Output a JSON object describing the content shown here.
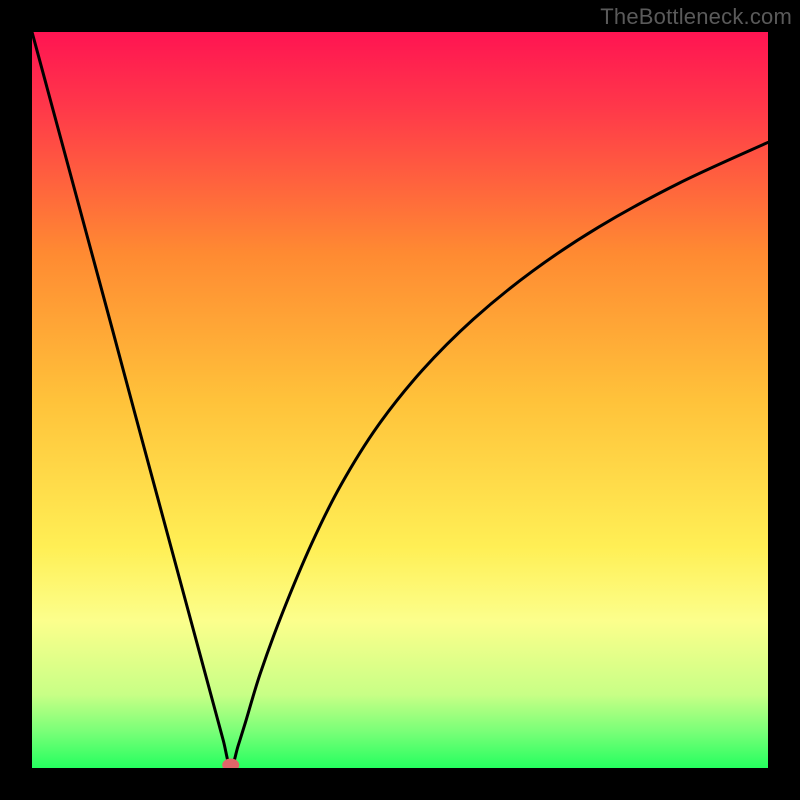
{
  "watermark": "TheBottleneck.com",
  "colors": {
    "frame": "#000000",
    "gradient_top": "#ff1452",
    "gradient_mid_upper": "#ff7a2e",
    "gradient_mid": "#ffb436",
    "gradient_mid_lower": "#ffe74a",
    "gradient_light": "#fbff8a",
    "gradient_green_light": "#b0ff7a",
    "gradient_green": "#2aff67",
    "curve": "#000000",
    "marker": "#e0666a"
  },
  "chart_data": {
    "type": "line",
    "title": "",
    "xlabel": "",
    "ylabel": "",
    "xlim": [
      0,
      100
    ],
    "ylim": [
      0,
      100
    ],
    "curve_notes": "V-shaped bottleneck curve: starts at (0,100), descends steeply and nearly linearly to a minimum near x≈27 where y≈0, then rises with decreasing slope approaching ~85 at x=100.",
    "series": [
      {
        "name": "curve",
        "x": [
          0,
          2,
          5,
          8,
          11,
          14,
          17,
          20,
          23,
          25,
          26,
          27,
          28,
          29,
          31,
          34,
          38,
          42,
          47,
          53,
          60,
          68,
          77,
          88,
          100
        ],
        "y": [
          100,
          92.6,
          81.5,
          70.4,
          59.3,
          48.1,
          37.0,
          25.9,
          14.8,
          7.4,
          3.7,
          0.0,
          3.0,
          6.2,
          12.8,
          21.0,
          30.5,
          38.5,
          46.5,
          54.0,
          61.0,
          67.5,
          73.5,
          79.5,
          85.0
        ]
      }
    ],
    "marker": {
      "x": 27,
      "y": 0
    },
    "gradient_stops": [
      {
        "offset": 0.0,
        "color": "#ff1452"
      },
      {
        "offset": 0.1,
        "color": "#ff374a"
      },
      {
        "offset": 0.3,
        "color": "#ff8a32"
      },
      {
        "offset": 0.5,
        "color": "#ffc23a"
      },
      {
        "offset": 0.7,
        "color": "#ffef55"
      },
      {
        "offset": 0.8,
        "color": "#fcff8c"
      },
      {
        "offset": 0.9,
        "color": "#c8ff86"
      },
      {
        "offset": 0.95,
        "color": "#7aff78"
      },
      {
        "offset": 1.0,
        "color": "#25ff5f"
      }
    ]
  }
}
